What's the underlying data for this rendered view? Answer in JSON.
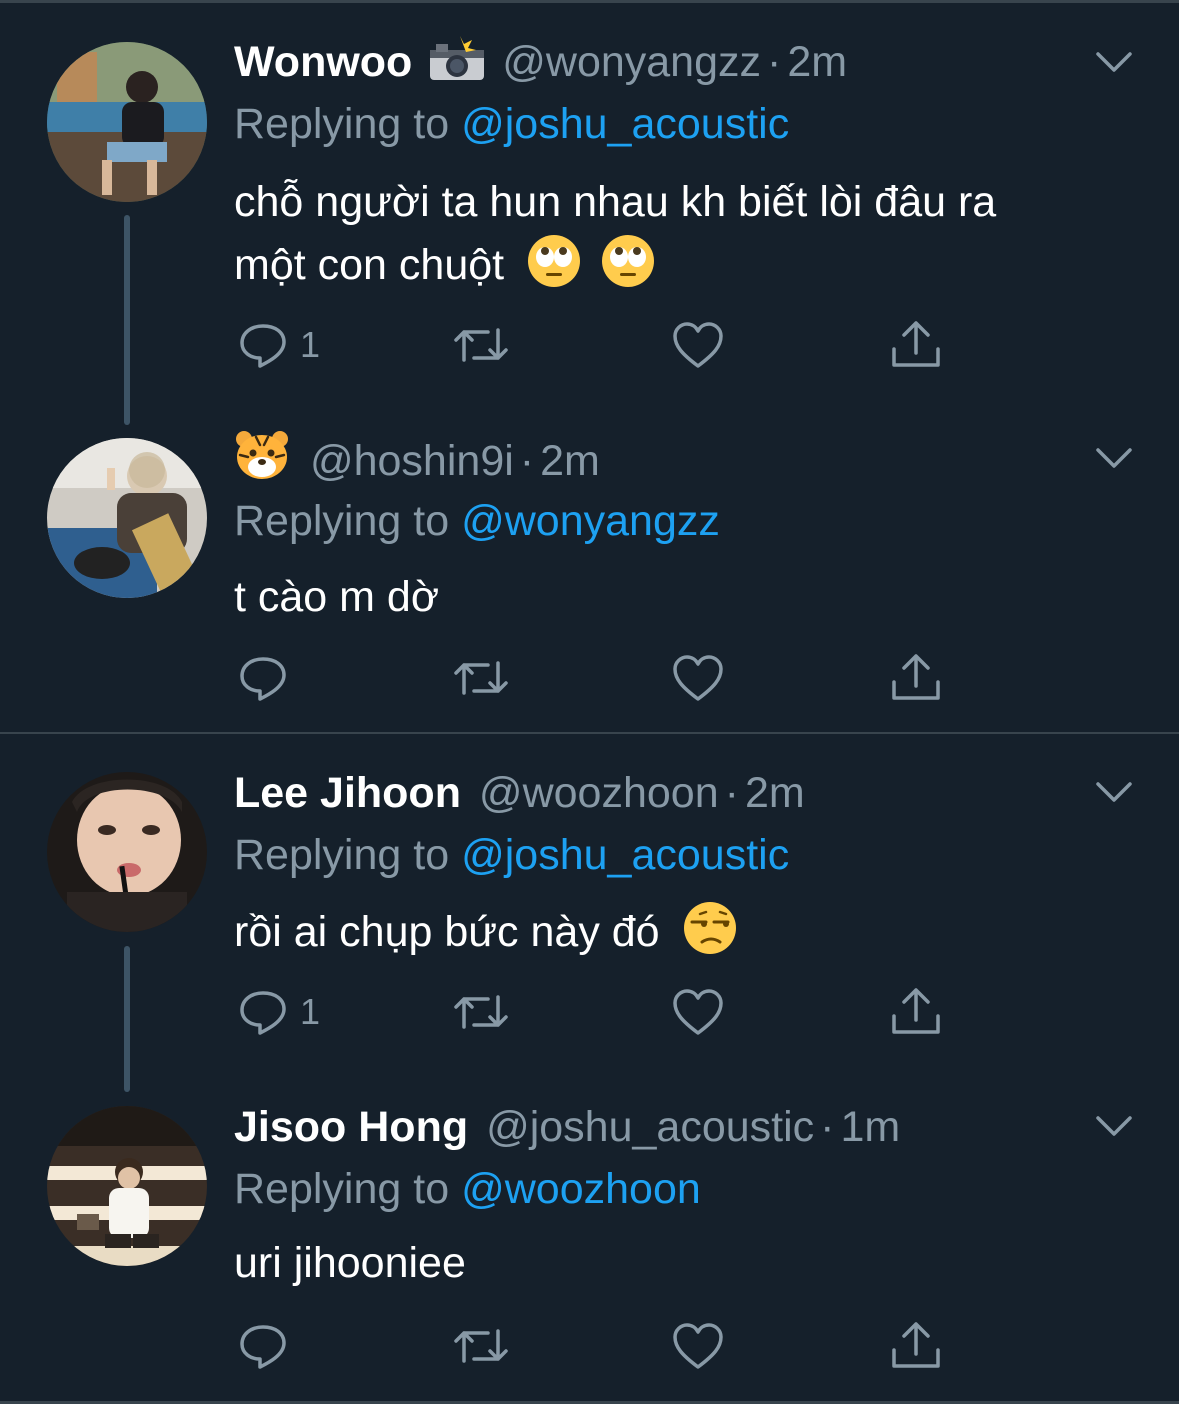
{
  "tweets": [
    {
      "name": "Wonwoo",
      "name_emoji": "camera-flash-icon",
      "handle": "@wonyangzz",
      "dot": "·",
      "time": "2m",
      "replying_prefix": "Replying to",
      "replying_to": "@joshu_acoustic",
      "text_line1": "chỗ người ta hun nhau kh biết lòi đâu ra",
      "text_line2": "một con chuột",
      "reply_count": "1"
    },
    {
      "name": "",
      "name_emoji": "tiger-face-icon",
      "handle": "@hoshin9i",
      "dot": "·",
      "time": "2m",
      "replying_prefix": "Replying to",
      "replying_to": "@wonyangzz",
      "text_line1": "t cào m dờ",
      "reply_count": ""
    },
    {
      "name": "Lee Jihoon",
      "handle": "@woozhoon",
      "dot": "·",
      "time": "2m",
      "replying_prefix": "Replying to",
      "replying_to": "@joshu_acoustic",
      "text_line1": "rồi ai chụp bức này đó",
      "reply_count": "1"
    },
    {
      "name": "Jisoo Hong",
      "handle": "@joshu_acoustic",
      "dot": "·",
      "time": "1m",
      "replying_prefix": "Replying to",
      "replying_to": "@woozhoon",
      "text_line1": "uri jihooniee",
      "reply_count": ""
    }
  ],
  "colors": {
    "background": "#15202b",
    "text_primary": "#ffffff",
    "text_secondary": "#8899a6",
    "link": "#1da1f2",
    "thread_line": "#3d5466",
    "divider": "#38444d"
  }
}
